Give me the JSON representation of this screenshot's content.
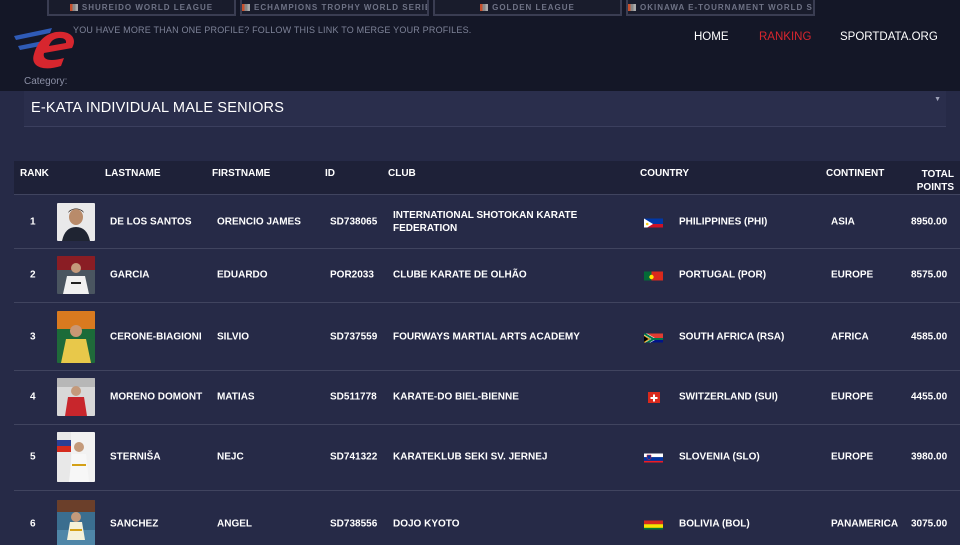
{
  "leagues": [
    {
      "label": "SHUREIDO WORLD LEAGUE"
    },
    {
      "label": "ECHAMPIONS TROPHY WORLD SERIES"
    },
    {
      "label": "GOLDEN LEAGUE"
    },
    {
      "label": "OKINAWA E-TOURNAMENT WORLD SERIES"
    }
  ],
  "header": {
    "merge_notice": "YOU HAVE MORE THAN ONE PROFILE? FOLLOW THIS LINK TO MERGE YOUR PROFILES.",
    "nav": [
      {
        "label": "HOME",
        "active": false
      },
      {
        "label": "RANKING",
        "active": true
      },
      {
        "label": "SPORTDATA.ORG",
        "active": false
      }
    ],
    "accent_color": "#d7262e",
    "logo_color": "#d7262e",
    "logo_secondary_color": "#2f5bb7"
  },
  "category": {
    "label": "Category:",
    "selected": "E-KATA INDIVIDUAL MALE SENIORS"
  },
  "table": {
    "headers": {
      "rank": "RANK",
      "lastname": "LASTNAME",
      "firstname": "FIRSTNAME",
      "id": "ID",
      "club": "CLUB",
      "country": "COUNTRY",
      "continent": "CONTINENT",
      "total_points": "TOTAL POINTS"
    },
    "rows": [
      {
        "rank": "1",
        "lastname": "DE LOS SANTOS",
        "firstname": "ORENCIO JAMES",
        "id": "SD738065",
        "club": "INTERNATIONAL SHOTOKAN KARATE FEDERATION",
        "country": "PHILIPPINES (PHI)",
        "continent": "ASIA",
        "points": "8950.00",
        "flag": "phi"
      },
      {
        "rank": "2",
        "lastname": "GARCIA",
        "firstname": "EDUARDO",
        "id": "POR2033",
        "club": "CLUBE KARATE DE OLHÃO",
        "country": "PORTUGAL (POR)",
        "continent": "EUROPE",
        "points": "8575.00",
        "flag": "por"
      },
      {
        "rank": "3",
        "lastname": "CERONE-BIAGIONI",
        "firstname": "SILVIO",
        "id": "SD737559",
        "club": "FOURWAYS MARTIAL ARTS ACADEMY",
        "country": "SOUTH AFRICA (RSA)",
        "continent": "AFRICA",
        "points": "4585.00",
        "flag": "rsa"
      },
      {
        "rank": "4",
        "lastname": "MORENO DOMONT",
        "firstname": "MATIAS",
        "id": "SD511778",
        "club": "KARATE-DO BIEL-BIENNE",
        "country": "SWITZERLAND (SUI)",
        "continent": "EUROPE",
        "points": "4455.00",
        "flag": "sui"
      },
      {
        "rank": "5",
        "lastname": "STERNIŠA",
        "firstname": "NEJC",
        "id": "SD741322",
        "club": "KARATEKLUB SEKI SV. JERNEJ",
        "country": "SLOVENIA (SLO)",
        "continent": "EUROPE",
        "points": "3980.00",
        "flag": "slo"
      },
      {
        "rank": "6",
        "lastname": "SANCHEZ",
        "firstname": "ANGEL",
        "id": "SD738556",
        "club": "DOJO KYOTO",
        "country": "BOLIVIA (BOL)",
        "continent": "PANAMERICA",
        "points": "3075.00",
        "flag": "bol"
      }
    ]
  }
}
